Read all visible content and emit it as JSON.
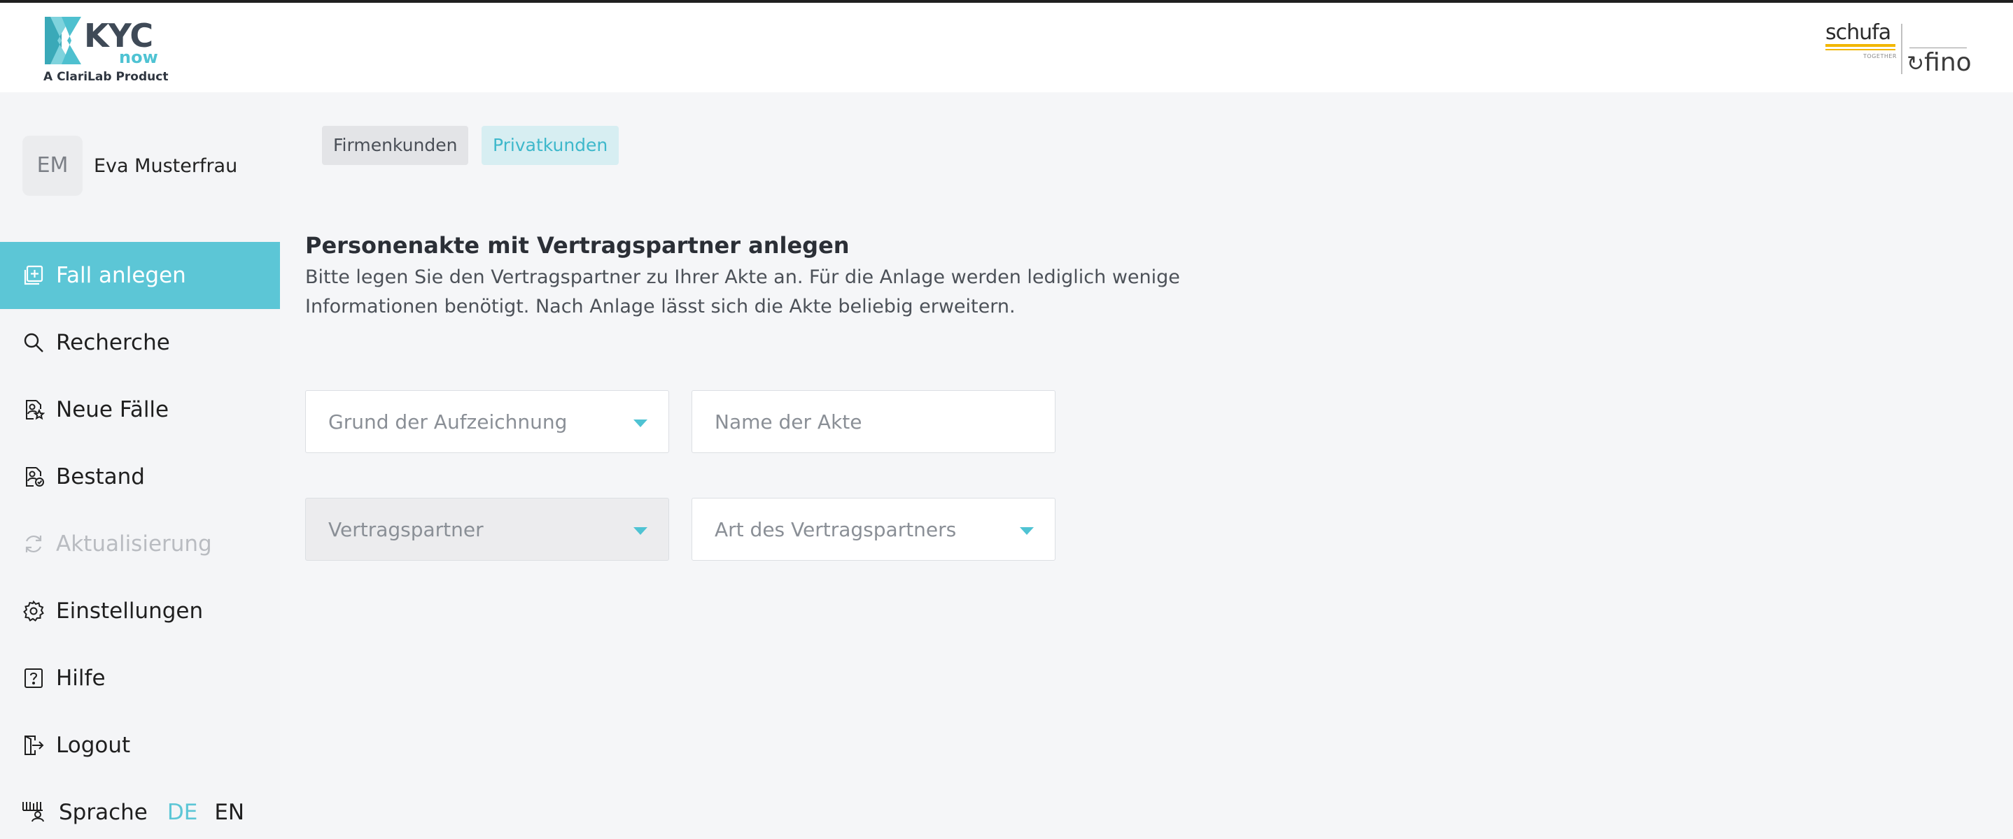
{
  "brand": {
    "name": "KYC",
    "sub": "now",
    "tagline": "A ClariLab Product"
  },
  "partners": {
    "schufa": "schufa",
    "schufa_tagline": "TOGETHER",
    "fino": "fino"
  },
  "user": {
    "initials": "EM",
    "name": "Eva Musterfrau"
  },
  "sidebar": {
    "items": [
      {
        "label": "Fall anlegen",
        "icon": "add-file-icon",
        "active": true
      },
      {
        "label": "Recherche",
        "icon": "search-icon"
      },
      {
        "label": "Neue Fälle",
        "icon": "new-cases-icon"
      },
      {
        "label": "Bestand",
        "icon": "portfolio-icon"
      },
      {
        "label": "Aktualisierung",
        "icon": "refresh-icon",
        "disabled": true
      },
      {
        "label": "Einstellungen",
        "icon": "gear-icon"
      },
      {
        "label": "Hilfe",
        "icon": "help-icon"
      },
      {
        "label": "Logout",
        "icon": "logout-icon"
      }
    ],
    "language": {
      "label": "Sprache",
      "icon": "language-icon",
      "options": [
        "DE",
        "EN"
      ],
      "active": "DE"
    }
  },
  "tabs": {
    "firmenkunden": "Firmenkunden",
    "privatkunden": "Privatkunden",
    "active": "Privatkunden"
  },
  "form": {
    "heading": "Personenakte mit Vertragspartner anlegen",
    "description": "Bitte legen Sie den Vertragspartner zu Ihrer Akte an. Für die Anlage werden lediglich wenige Informationen benötigt. Nach Anlage lässt sich die Akte beliebig erweitern.",
    "grund": "Grund der Aufzeichnung",
    "name_placeholder": "Name der Akte",
    "vertragspartner": "Vertragspartner",
    "art": "Art des Vertragspartners"
  },
  "colors": {
    "accent": "#5cc6d6",
    "text": "#1f1f1f",
    "muted": "#8a8f96",
    "disabled": "#b9bcc1"
  }
}
